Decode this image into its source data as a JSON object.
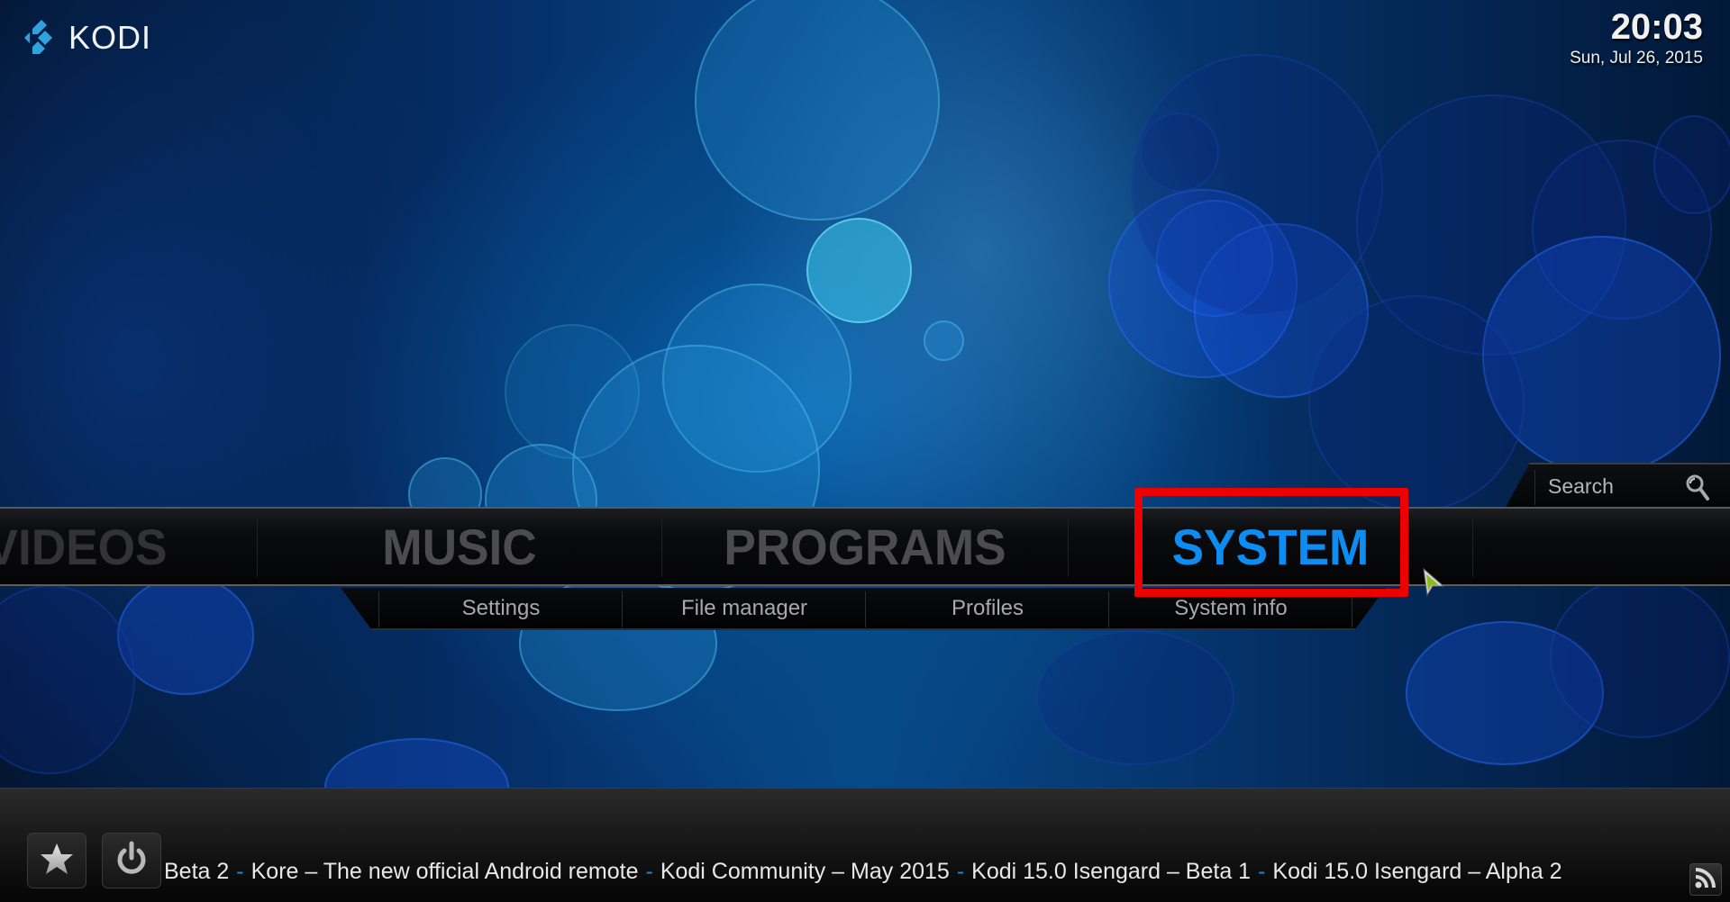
{
  "app": {
    "logo_text": "KODI"
  },
  "clock": {
    "time": "20:03",
    "date": "Sun, Jul 26, 2015"
  },
  "search": {
    "label": "Search",
    "icon": "magnifier-icon"
  },
  "main_menu": {
    "items": [
      {
        "label": "VIDEOS",
        "state": "partially-visible"
      },
      {
        "label": "MUSIC",
        "state": "normal"
      },
      {
        "label": "PROGRAMS",
        "state": "normal"
      },
      {
        "label": "SYSTEM",
        "state": "focused"
      }
    ],
    "active_color": "#0d8cf2"
  },
  "sub_menu": {
    "items": [
      {
        "label": "Settings"
      },
      {
        "label": "File manager"
      },
      {
        "label": "Profiles"
      },
      {
        "label": "System info"
      }
    ]
  },
  "annotation": {
    "highlight_color": "#ee0000",
    "target": "SYSTEM"
  },
  "bottom_bar": {
    "favourites_icon": "star-icon",
    "power_icon": "power-icon",
    "rss_icon": "rss-icon",
    "ticker": [
      "Beta 2",
      "Kore – The new official Android remote",
      "Kodi Community – May 2015",
      "Kodi 15.0 Isengard – Beta 1",
      "Kodi 15.0 Isengard – Alpha 2"
    ],
    "ticker_separator": "-",
    "separator_color": "#1b87e8"
  }
}
